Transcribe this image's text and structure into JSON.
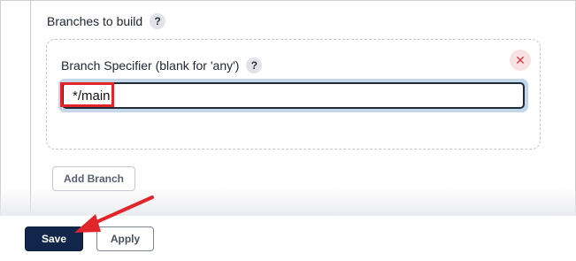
{
  "section": {
    "title": "Branches to build",
    "help": "?"
  },
  "branch": {
    "label": "Branch Specifier (blank for 'any')",
    "help": "?",
    "remove_icon": "close-icon",
    "remove_glyph": "✕",
    "value": "*/main"
  },
  "actions": {
    "add_branch": "Add Branch",
    "save": "Save",
    "apply": "Apply"
  },
  "colors": {
    "annotation_red": "#e2252b",
    "save_bg": "#11264a"
  }
}
